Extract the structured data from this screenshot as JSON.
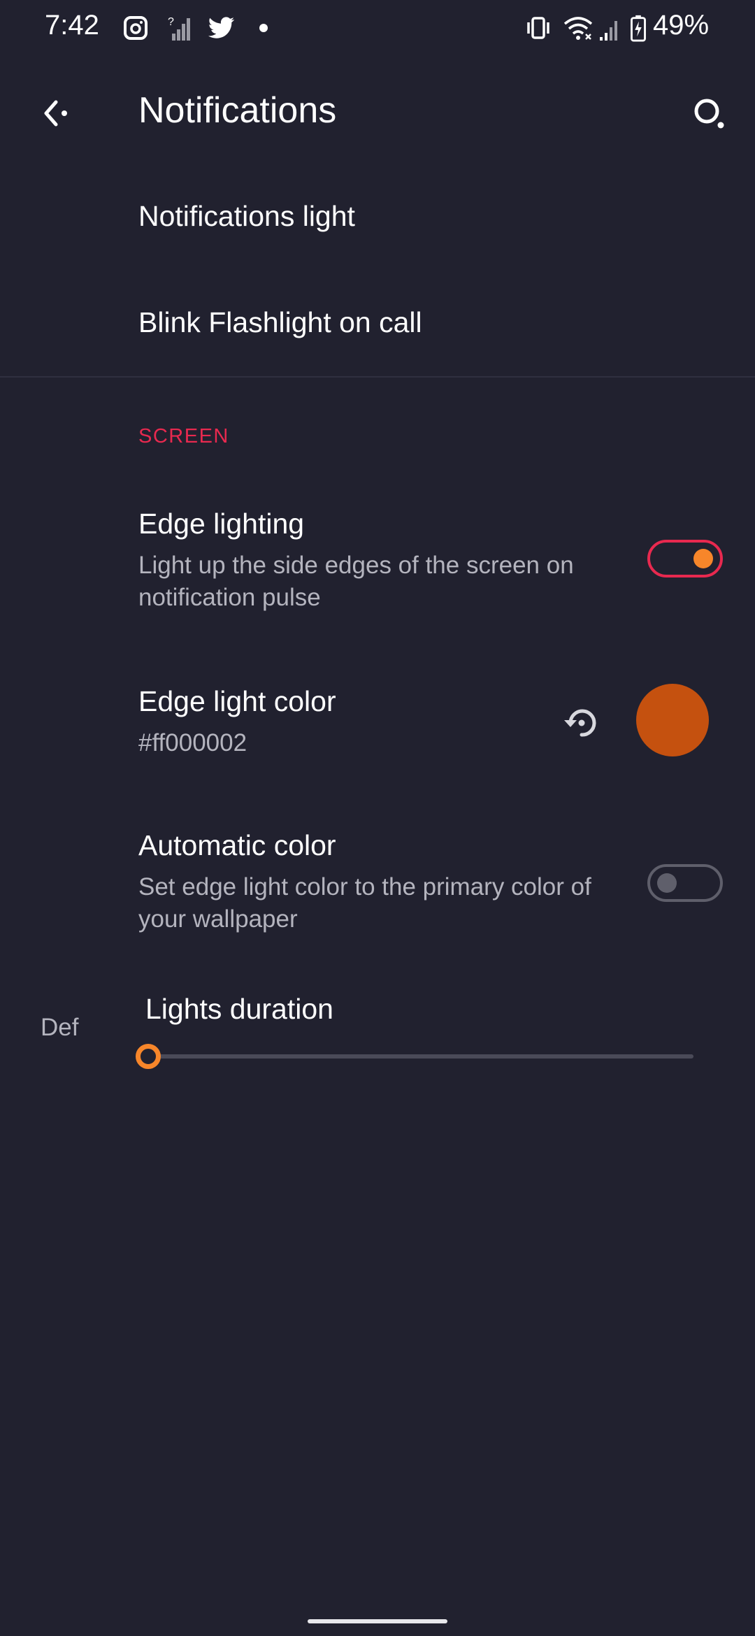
{
  "status_bar": {
    "time": "7:42",
    "left_icons": [
      "camera-app-icon",
      "signal-unknown-icon",
      "twitter-icon",
      "notification-dot"
    ],
    "right_icons": [
      "vibrate-icon",
      "wifi-icon",
      "cellular-signal-icon",
      "battery-charging-icon"
    ],
    "battery_percent": "49%"
  },
  "app_bar": {
    "title": "Notifications",
    "back_icon": "back-arrow-icon",
    "search_icon": "search-icon"
  },
  "items": {
    "notifications_light": {
      "title": "Notifications light"
    },
    "blink_flashlight": {
      "title": "Blink Flashlight on call"
    }
  },
  "section": {
    "title": "SCREEN",
    "color": "#e8294f"
  },
  "edge_lighting": {
    "title": "Edge lighting",
    "summary": "Light up the side edges of the screen on notification pulse",
    "enabled": true
  },
  "edge_light_color": {
    "title": "Edge light color",
    "value": "#ff000002",
    "swatch_color": "#c5510f",
    "reset_icon": "reset-history-icon"
  },
  "automatic_color": {
    "title": "Automatic color",
    "summary": "Set edge light color to the primary color of your wallpaper",
    "enabled": false
  },
  "lights_duration": {
    "title": "Lights duration",
    "side_label": "Def",
    "level": 0
  },
  "colors": {
    "background": "#21212f",
    "accent_orange": "#f7862a",
    "accent_red": "#e8294f",
    "switch_off": "#5f5f6b"
  }
}
